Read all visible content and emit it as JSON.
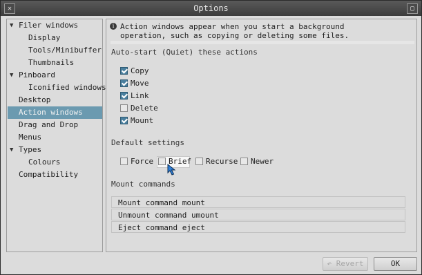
{
  "window": {
    "title": "Options",
    "close_glyph": "✕",
    "max_glyph": "▢"
  },
  "sidebar": {
    "items": [
      {
        "label": "Filer windows",
        "expand": "▼"
      },
      {
        "label": "Display"
      },
      {
        "label": "Tools/Minibuffer"
      },
      {
        "label": "Thumbnails"
      },
      {
        "label": "Pinboard",
        "expand": "▼"
      },
      {
        "label": "Iconified windows"
      },
      {
        "label": "Desktop"
      },
      {
        "label": "Action windows",
        "selected": true
      },
      {
        "label": "Drag and Drop"
      },
      {
        "label": "Menus"
      },
      {
        "label": "Types",
        "expand": "▼"
      },
      {
        "label": "Colours"
      },
      {
        "label": "Compatibility"
      }
    ]
  },
  "main": {
    "info_icon": "info-icon",
    "info_glyph": "i",
    "info_text": "Action windows appear when you start a background\noperation, such as copying or deleting some files.",
    "autostart_heading": "Auto-start (Quiet) these actions",
    "autostart": [
      {
        "label": "Copy",
        "checked": true
      },
      {
        "label": "Move",
        "checked": true
      },
      {
        "label": "Link",
        "checked": true
      },
      {
        "label": "Delete",
        "checked": false
      },
      {
        "label": "Mount",
        "checked": true
      }
    ],
    "defaults_heading": "Default settings",
    "defaults": [
      {
        "label": "Force",
        "checked": false
      },
      {
        "label": "Brief",
        "checked": false
      },
      {
        "label": "Recurse",
        "checked": false
      },
      {
        "label": "Newer",
        "checked": false
      }
    ],
    "mount_heading": "Mount commands",
    "mount_commands": [
      {
        "text": "Mount command mount"
      },
      {
        "text": "Unmount command umount"
      },
      {
        "text": "Eject command eject"
      }
    ]
  },
  "buttons": {
    "revert": "Revert",
    "revert_icon": "↶",
    "ok": "OK"
  },
  "colors": {
    "accent": "#6b9ab0",
    "checkbox_on": "#4a7f9e",
    "cursor": "#2f7fd8"
  }
}
